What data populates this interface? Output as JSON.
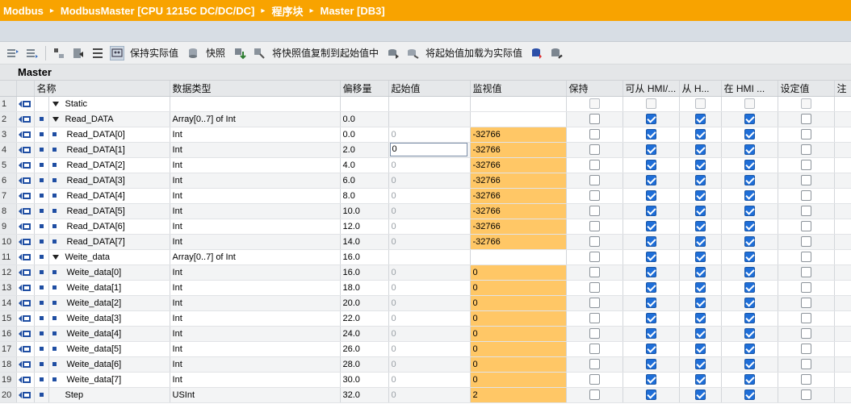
{
  "breadcrumb": {
    "items": [
      "Modbus",
      "ModbusMaster [CPU 1215C DC/DC/DC]",
      "程序块",
      "Master [DB3]"
    ],
    "separator": "▸"
  },
  "toolbar": {
    "keep_actual_label": "保持实际值",
    "snapshot_label": "快照",
    "copy_snapshot_label": "将快照值复制到起始值中",
    "load_start_label": "将起始值加载为实际值"
  },
  "block": {
    "title": "Master"
  },
  "table": {
    "headers": {
      "name": "名称",
      "type": "数据类型",
      "offset": "偏移量",
      "start": "起始值",
      "monitor": "监视值",
      "retain": "保持",
      "hmi_access": "可从 HMI/...",
      "hmi_write": "从 H...",
      "hmi_visible": "在 HMI ...",
      "setpoint": "设定值",
      "comment": "注"
    },
    "rows": [
      {
        "num": "1",
        "indent": 0,
        "marker": false,
        "expand": true,
        "name": "Static",
        "type": "",
        "offset": "",
        "start": "",
        "monitor": "",
        "mon_cell": false,
        "retain": false,
        "hmi_access": false,
        "hmi_write": false,
        "hmi_visible": false,
        "setpoint": false,
        "dim": true
      },
      {
        "num": "2",
        "indent": 1,
        "marker": true,
        "expand": true,
        "name": "Read_DATA",
        "type": "Array[0..7] of Int",
        "offset": "0.0",
        "start": "",
        "monitor": "",
        "mon_cell": false,
        "retain": false,
        "hmi_access": true,
        "hmi_write": true,
        "hmi_visible": true,
        "setpoint": false,
        "dim": false
      },
      {
        "num": "3",
        "indent": 2,
        "marker": true,
        "expand": false,
        "name": "Read_DATA[0]",
        "type": "Int",
        "offset": "0.0",
        "start": "0",
        "monitor": "-32766",
        "mon_cell": true,
        "retain": false,
        "hmi_access": true,
        "hmi_write": true,
        "hmi_visible": true,
        "setpoint": false,
        "dim": false
      },
      {
        "num": "4",
        "indent": 2,
        "marker": true,
        "expand": false,
        "name": "Read_DATA[1]",
        "type": "Int",
        "offset": "2.0",
        "start": "0",
        "monitor": "-32766",
        "mon_cell": true,
        "edit": true,
        "retain": false,
        "hmi_access": true,
        "hmi_write": true,
        "hmi_visible": true,
        "setpoint": false,
        "dim": false
      },
      {
        "num": "5",
        "indent": 2,
        "marker": true,
        "expand": false,
        "name": "Read_DATA[2]",
        "type": "Int",
        "offset": "4.0",
        "start": "0",
        "monitor": "-32766",
        "mon_cell": true,
        "retain": false,
        "hmi_access": true,
        "hmi_write": true,
        "hmi_visible": true,
        "setpoint": false,
        "dim": false
      },
      {
        "num": "6",
        "indent": 2,
        "marker": true,
        "expand": false,
        "name": "Read_DATA[3]",
        "type": "Int",
        "offset": "6.0",
        "start": "0",
        "monitor": "-32766",
        "mon_cell": true,
        "retain": false,
        "hmi_access": true,
        "hmi_write": true,
        "hmi_visible": true,
        "setpoint": false,
        "dim": false
      },
      {
        "num": "7",
        "indent": 2,
        "marker": true,
        "expand": false,
        "name": "Read_DATA[4]",
        "type": "Int",
        "offset": "8.0",
        "start": "0",
        "monitor": "-32766",
        "mon_cell": true,
        "retain": false,
        "hmi_access": true,
        "hmi_write": true,
        "hmi_visible": true,
        "setpoint": false,
        "dim": false
      },
      {
        "num": "8",
        "indent": 2,
        "marker": true,
        "expand": false,
        "name": "Read_DATA[5]",
        "type": "Int",
        "offset": "10.0",
        "start": "0",
        "monitor": "-32766",
        "mon_cell": true,
        "retain": false,
        "hmi_access": true,
        "hmi_write": true,
        "hmi_visible": true,
        "setpoint": false,
        "dim": false
      },
      {
        "num": "9",
        "indent": 2,
        "marker": true,
        "expand": false,
        "name": "Read_DATA[6]",
        "type": "Int",
        "offset": "12.0",
        "start": "0",
        "monitor": "-32766",
        "mon_cell": true,
        "retain": false,
        "hmi_access": true,
        "hmi_write": true,
        "hmi_visible": true,
        "setpoint": false,
        "dim": false
      },
      {
        "num": "10",
        "indent": 2,
        "marker": true,
        "expand": false,
        "name": "Read_DATA[7]",
        "type": "Int",
        "offset": "14.0",
        "start": "0",
        "monitor": "-32766",
        "mon_cell": true,
        "retain": false,
        "hmi_access": true,
        "hmi_write": true,
        "hmi_visible": true,
        "setpoint": false,
        "dim": false
      },
      {
        "num": "11",
        "indent": 1,
        "marker": true,
        "expand": true,
        "name": "Weite_data",
        "type": "Array[0..7] of Int",
        "offset": "16.0",
        "start": "",
        "monitor": "",
        "mon_cell": false,
        "retain": false,
        "hmi_access": true,
        "hmi_write": true,
        "hmi_visible": true,
        "setpoint": false,
        "dim": false
      },
      {
        "num": "12",
        "indent": 2,
        "marker": true,
        "expand": false,
        "name": "Weite_data[0]",
        "type": "Int",
        "offset": "16.0",
        "start": "0",
        "monitor": "0",
        "mon_cell": true,
        "retain": false,
        "hmi_access": true,
        "hmi_write": true,
        "hmi_visible": true,
        "setpoint": false,
        "dim": false
      },
      {
        "num": "13",
        "indent": 2,
        "marker": true,
        "expand": false,
        "name": "Weite_data[1]",
        "type": "Int",
        "offset": "18.0",
        "start": "0",
        "monitor": "0",
        "mon_cell": true,
        "retain": false,
        "hmi_access": true,
        "hmi_write": true,
        "hmi_visible": true,
        "setpoint": false,
        "dim": false
      },
      {
        "num": "14",
        "indent": 2,
        "marker": true,
        "expand": false,
        "name": "Weite_data[2]",
        "type": "Int",
        "offset": "20.0",
        "start": "0",
        "monitor": "0",
        "mon_cell": true,
        "retain": false,
        "hmi_access": true,
        "hmi_write": true,
        "hmi_visible": true,
        "setpoint": false,
        "dim": false
      },
      {
        "num": "15",
        "indent": 2,
        "marker": true,
        "expand": false,
        "name": "Weite_data[3]",
        "type": "Int",
        "offset": "22.0",
        "start": "0",
        "monitor": "0",
        "mon_cell": true,
        "retain": false,
        "hmi_access": true,
        "hmi_write": true,
        "hmi_visible": true,
        "setpoint": false,
        "dim": false
      },
      {
        "num": "16",
        "indent": 2,
        "marker": true,
        "expand": false,
        "name": "Weite_data[4]",
        "type": "Int",
        "offset": "24.0",
        "start": "0",
        "monitor": "0",
        "mon_cell": true,
        "retain": false,
        "hmi_access": true,
        "hmi_write": true,
        "hmi_visible": true,
        "setpoint": false,
        "dim": false
      },
      {
        "num": "17",
        "indent": 2,
        "marker": true,
        "expand": false,
        "name": "Weite_data[5]",
        "type": "Int",
        "offset": "26.0",
        "start": "0",
        "monitor": "0",
        "mon_cell": true,
        "retain": false,
        "hmi_access": true,
        "hmi_write": true,
        "hmi_visible": true,
        "setpoint": false,
        "dim": false
      },
      {
        "num": "18",
        "indent": 2,
        "marker": true,
        "expand": false,
        "name": "Weite_data[6]",
        "type": "Int",
        "offset": "28.0",
        "start": "0",
        "monitor": "0",
        "mon_cell": true,
        "retain": false,
        "hmi_access": true,
        "hmi_write": true,
        "hmi_visible": true,
        "setpoint": false,
        "dim": false
      },
      {
        "num": "19",
        "indent": 2,
        "marker": true,
        "expand": false,
        "name": "Weite_data[7]",
        "type": "Int",
        "offset": "30.0",
        "start": "0",
        "monitor": "0",
        "mon_cell": true,
        "retain": false,
        "hmi_access": true,
        "hmi_write": true,
        "hmi_visible": true,
        "setpoint": false,
        "dim": false
      },
      {
        "num": "20",
        "indent": 1,
        "marker": true,
        "expand": false,
        "name": "Step",
        "type": "USInt",
        "offset": "32.0",
        "start": "0",
        "monitor": "2",
        "mon_cell": true,
        "retain": false,
        "hmi_access": true,
        "hmi_write": true,
        "hmi_visible": true,
        "setpoint": false,
        "dim": false
      }
    ]
  },
  "colors": {
    "titlebar": "#f8a300",
    "monitor_cell": "#ffc766",
    "checkbox_on": "#1e6ed8"
  }
}
